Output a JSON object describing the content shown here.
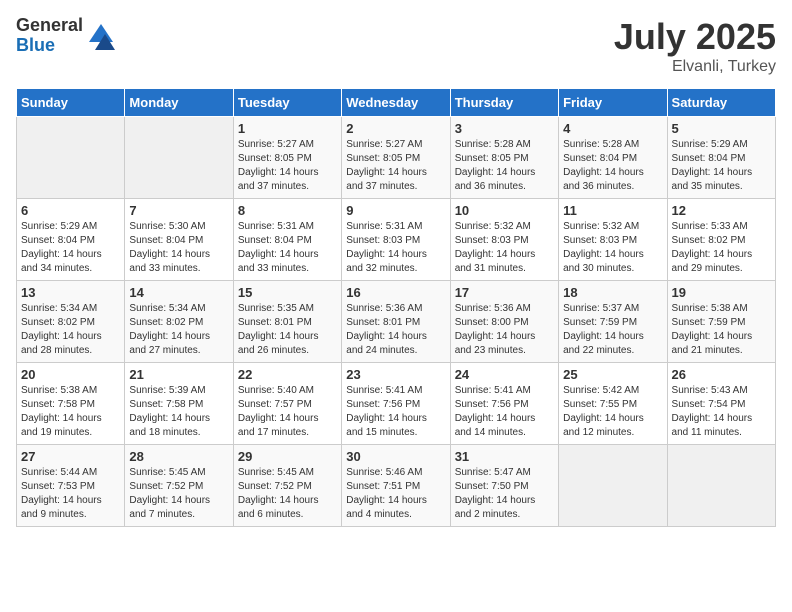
{
  "header": {
    "logo_general": "General",
    "logo_blue": "Blue",
    "month_year": "July 2025",
    "location": "Elvanli, Turkey"
  },
  "weekdays": [
    "Sunday",
    "Monday",
    "Tuesday",
    "Wednesday",
    "Thursday",
    "Friday",
    "Saturday"
  ],
  "weeks": [
    [
      {
        "day": "",
        "sunrise": "",
        "sunset": "",
        "daylight": ""
      },
      {
        "day": "",
        "sunrise": "",
        "sunset": "",
        "daylight": ""
      },
      {
        "day": "1",
        "sunrise": "Sunrise: 5:27 AM",
        "sunset": "Sunset: 8:05 PM",
        "daylight": "Daylight: 14 hours and 37 minutes."
      },
      {
        "day": "2",
        "sunrise": "Sunrise: 5:27 AM",
        "sunset": "Sunset: 8:05 PM",
        "daylight": "Daylight: 14 hours and 37 minutes."
      },
      {
        "day": "3",
        "sunrise": "Sunrise: 5:28 AM",
        "sunset": "Sunset: 8:05 PM",
        "daylight": "Daylight: 14 hours and 36 minutes."
      },
      {
        "day": "4",
        "sunrise": "Sunrise: 5:28 AM",
        "sunset": "Sunset: 8:04 PM",
        "daylight": "Daylight: 14 hours and 36 minutes."
      },
      {
        "day": "5",
        "sunrise": "Sunrise: 5:29 AM",
        "sunset": "Sunset: 8:04 PM",
        "daylight": "Daylight: 14 hours and 35 minutes."
      }
    ],
    [
      {
        "day": "6",
        "sunrise": "Sunrise: 5:29 AM",
        "sunset": "Sunset: 8:04 PM",
        "daylight": "Daylight: 14 hours and 34 minutes."
      },
      {
        "day": "7",
        "sunrise": "Sunrise: 5:30 AM",
        "sunset": "Sunset: 8:04 PM",
        "daylight": "Daylight: 14 hours and 33 minutes."
      },
      {
        "day": "8",
        "sunrise": "Sunrise: 5:31 AM",
        "sunset": "Sunset: 8:04 PM",
        "daylight": "Daylight: 14 hours and 33 minutes."
      },
      {
        "day": "9",
        "sunrise": "Sunrise: 5:31 AM",
        "sunset": "Sunset: 8:03 PM",
        "daylight": "Daylight: 14 hours and 32 minutes."
      },
      {
        "day": "10",
        "sunrise": "Sunrise: 5:32 AM",
        "sunset": "Sunset: 8:03 PM",
        "daylight": "Daylight: 14 hours and 31 minutes."
      },
      {
        "day": "11",
        "sunrise": "Sunrise: 5:32 AM",
        "sunset": "Sunset: 8:03 PM",
        "daylight": "Daylight: 14 hours and 30 minutes."
      },
      {
        "day": "12",
        "sunrise": "Sunrise: 5:33 AM",
        "sunset": "Sunset: 8:02 PM",
        "daylight": "Daylight: 14 hours and 29 minutes."
      }
    ],
    [
      {
        "day": "13",
        "sunrise": "Sunrise: 5:34 AM",
        "sunset": "Sunset: 8:02 PM",
        "daylight": "Daylight: 14 hours and 28 minutes."
      },
      {
        "day": "14",
        "sunrise": "Sunrise: 5:34 AM",
        "sunset": "Sunset: 8:02 PM",
        "daylight": "Daylight: 14 hours and 27 minutes."
      },
      {
        "day": "15",
        "sunrise": "Sunrise: 5:35 AM",
        "sunset": "Sunset: 8:01 PM",
        "daylight": "Daylight: 14 hours and 26 minutes."
      },
      {
        "day": "16",
        "sunrise": "Sunrise: 5:36 AM",
        "sunset": "Sunset: 8:01 PM",
        "daylight": "Daylight: 14 hours and 24 minutes."
      },
      {
        "day": "17",
        "sunrise": "Sunrise: 5:36 AM",
        "sunset": "Sunset: 8:00 PM",
        "daylight": "Daylight: 14 hours and 23 minutes."
      },
      {
        "day": "18",
        "sunrise": "Sunrise: 5:37 AM",
        "sunset": "Sunset: 7:59 PM",
        "daylight": "Daylight: 14 hours and 22 minutes."
      },
      {
        "day": "19",
        "sunrise": "Sunrise: 5:38 AM",
        "sunset": "Sunset: 7:59 PM",
        "daylight": "Daylight: 14 hours and 21 minutes."
      }
    ],
    [
      {
        "day": "20",
        "sunrise": "Sunrise: 5:38 AM",
        "sunset": "Sunset: 7:58 PM",
        "daylight": "Daylight: 14 hours and 19 minutes."
      },
      {
        "day": "21",
        "sunrise": "Sunrise: 5:39 AM",
        "sunset": "Sunset: 7:58 PM",
        "daylight": "Daylight: 14 hours and 18 minutes."
      },
      {
        "day": "22",
        "sunrise": "Sunrise: 5:40 AM",
        "sunset": "Sunset: 7:57 PM",
        "daylight": "Daylight: 14 hours and 17 minutes."
      },
      {
        "day": "23",
        "sunrise": "Sunrise: 5:41 AM",
        "sunset": "Sunset: 7:56 PM",
        "daylight": "Daylight: 14 hours and 15 minutes."
      },
      {
        "day": "24",
        "sunrise": "Sunrise: 5:41 AM",
        "sunset": "Sunset: 7:56 PM",
        "daylight": "Daylight: 14 hours and 14 minutes."
      },
      {
        "day": "25",
        "sunrise": "Sunrise: 5:42 AM",
        "sunset": "Sunset: 7:55 PM",
        "daylight": "Daylight: 14 hours and 12 minutes."
      },
      {
        "day": "26",
        "sunrise": "Sunrise: 5:43 AM",
        "sunset": "Sunset: 7:54 PM",
        "daylight": "Daylight: 14 hours and 11 minutes."
      }
    ],
    [
      {
        "day": "27",
        "sunrise": "Sunrise: 5:44 AM",
        "sunset": "Sunset: 7:53 PM",
        "daylight": "Daylight: 14 hours and 9 minutes."
      },
      {
        "day": "28",
        "sunrise": "Sunrise: 5:45 AM",
        "sunset": "Sunset: 7:52 PM",
        "daylight": "Daylight: 14 hours and 7 minutes."
      },
      {
        "day": "29",
        "sunrise": "Sunrise: 5:45 AM",
        "sunset": "Sunset: 7:52 PM",
        "daylight": "Daylight: 14 hours and 6 minutes."
      },
      {
        "day": "30",
        "sunrise": "Sunrise: 5:46 AM",
        "sunset": "Sunset: 7:51 PM",
        "daylight": "Daylight: 14 hours and 4 minutes."
      },
      {
        "day": "31",
        "sunrise": "Sunrise: 5:47 AM",
        "sunset": "Sunset: 7:50 PM",
        "daylight": "Daylight: 14 hours and 2 minutes."
      },
      {
        "day": "",
        "sunrise": "",
        "sunset": "",
        "daylight": ""
      },
      {
        "day": "",
        "sunrise": "",
        "sunset": "",
        "daylight": ""
      }
    ]
  ]
}
